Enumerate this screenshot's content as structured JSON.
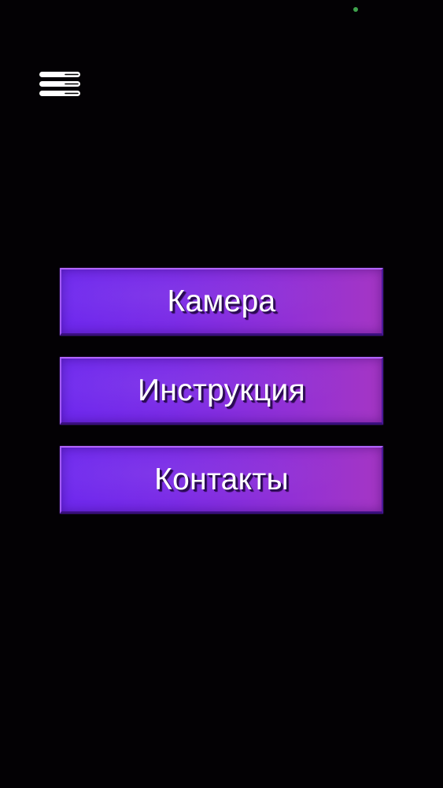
{
  "status_bar": {
    "indicator_color": "#3fa34d"
  },
  "header": {
    "menu_icon": "hamburger-menu-icon",
    "icon_color": "#ffffff"
  },
  "menu": {
    "items": [
      {
        "label": "Камера"
      },
      {
        "label": "Инструкция"
      },
      {
        "label": "Контакты"
      }
    ]
  },
  "theme": {
    "background": "#030104",
    "button_gradient_start": "#6a22ee",
    "button_gradient_end": "#a536c4",
    "button_text": "#ffffff"
  }
}
